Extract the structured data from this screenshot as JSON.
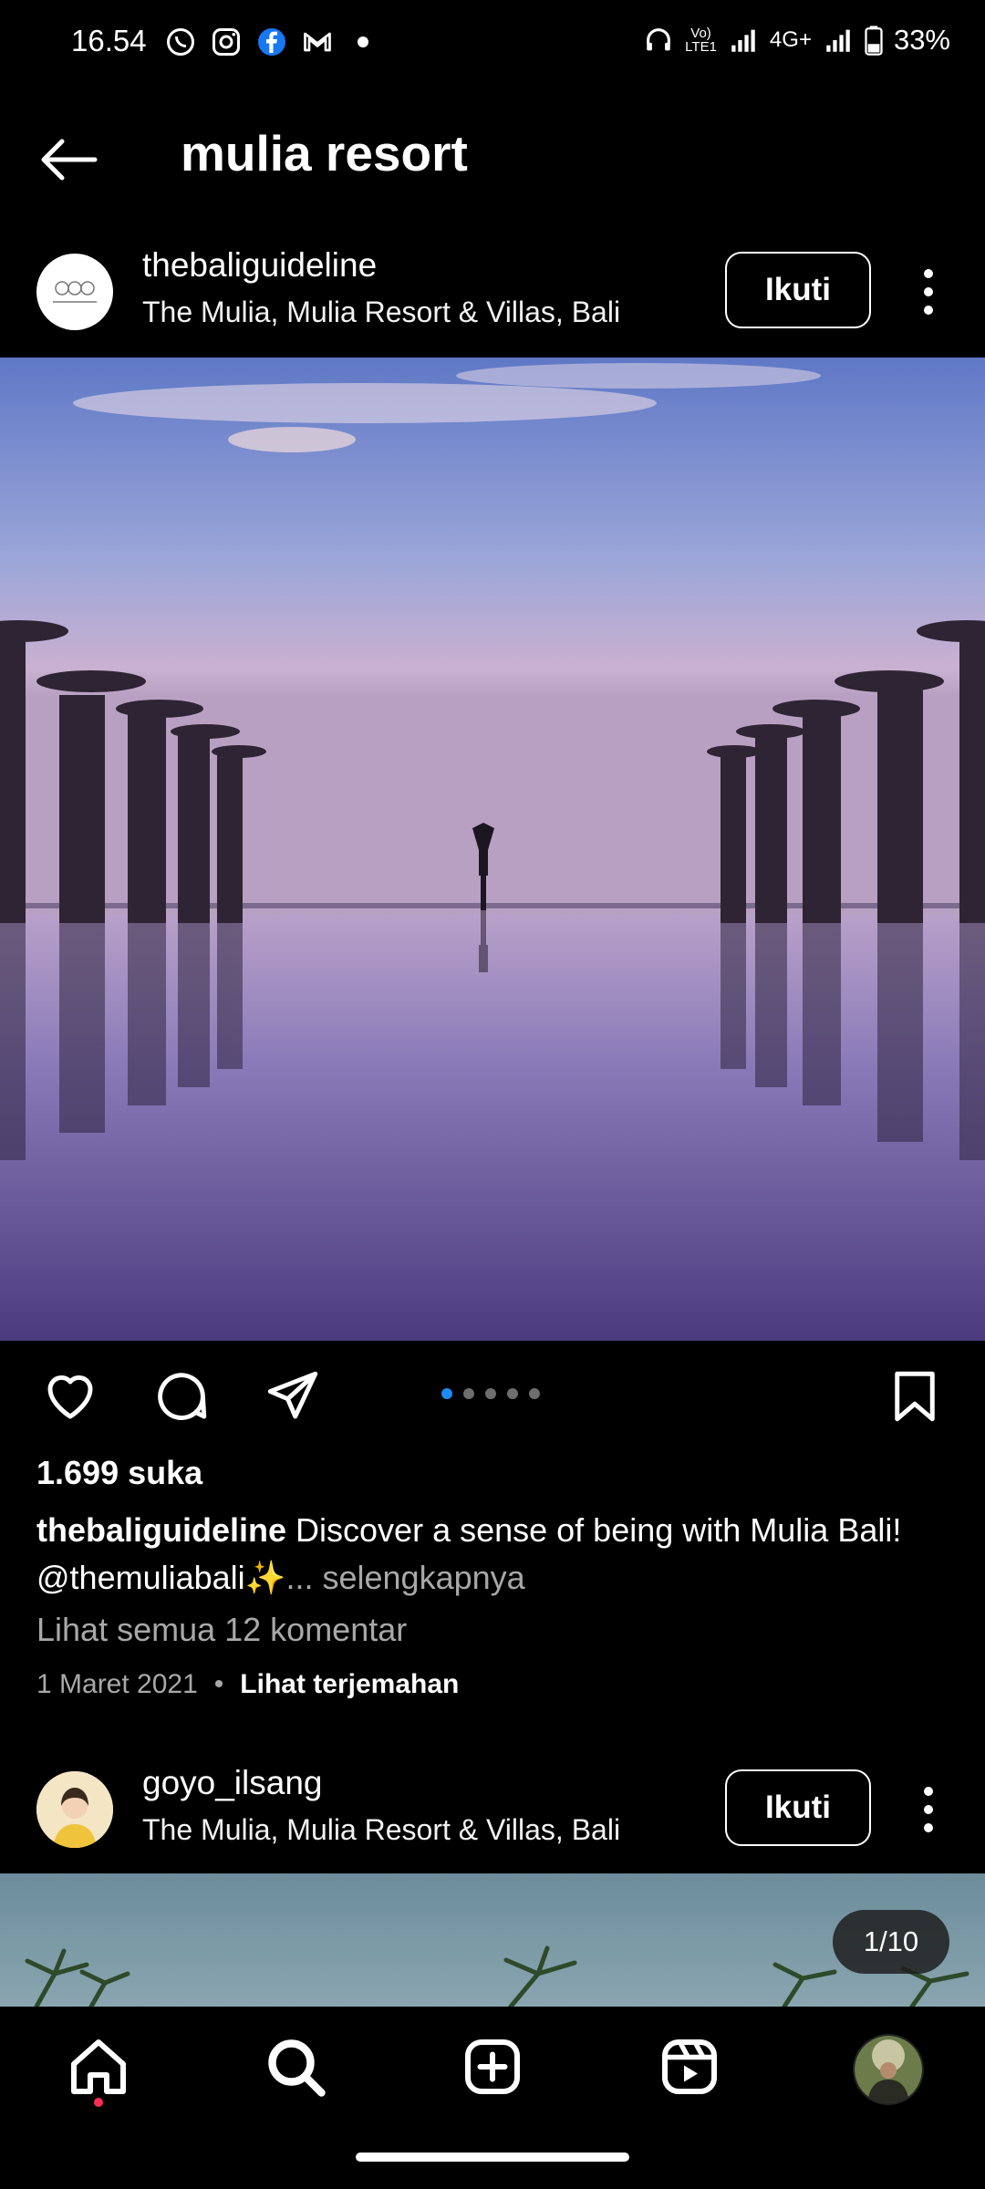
{
  "status_bar": {
    "time": "16.54",
    "network_label": "4G+",
    "lte_label": "LTE1",
    "battery": "33%",
    "icons": [
      "whatsapp-icon",
      "instagram-icon",
      "facebook-icon",
      "gmail-icon",
      "dot-icon",
      "headphones-icon",
      "volte-icon",
      "signal-icon",
      "signal-icon-2",
      "battery-icon"
    ]
  },
  "header": {
    "title": "mulia resort",
    "back_icon": "arrow-left-icon"
  },
  "posts": [
    {
      "username": "thebaliguideline",
      "location": "The Mulia, Mulia Resort & Villas, Bali",
      "follow_label": "Ikuti",
      "avatar_text": "THE BALI GUIDELINE",
      "likes": "1.699 suka",
      "caption_user": "thebaliguideline",
      "caption_text": " Discover a sense of being with Mulia Bali! @themuliabali✨",
      "caption_more": "... selengkapnya",
      "comments_link": "Lihat semua 12 komentar",
      "date": "1 Maret 2021",
      "separator": "•",
      "translate_label": "Lihat terjemahan",
      "carousel_total": 5,
      "carousel_active": 1
    },
    {
      "username": "goyo_ilsang",
      "location": "The Mulia, Mulia Resort & Villas, Bali",
      "follow_label": "Ikuti",
      "counter": "1/10"
    }
  ],
  "colors": {
    "accent": "#1b8cf5",
    "notification": "#ff2d55",
    "muted": "#a8a8a8"
  },
  "nav": {
    "items": [
      "home-icon",
      "search-icon",
      "create-icon",
      "reels-icon",
      "profile-avatar"
    ]
  }
}
